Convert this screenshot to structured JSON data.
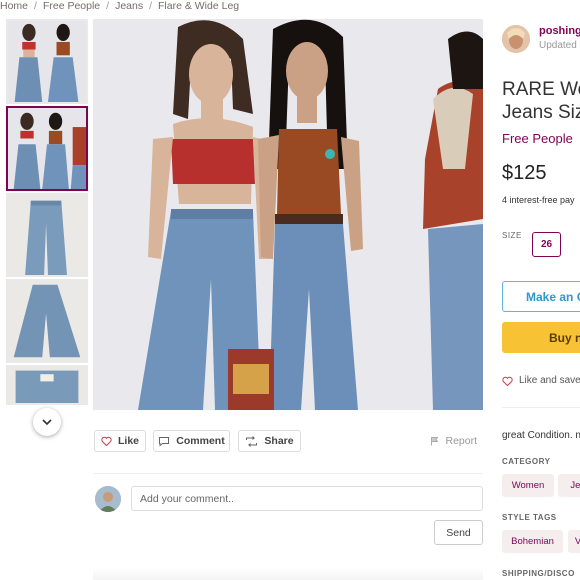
{
  "breadcrumb": [
    "Home",
    "Free People",
    "Jeans",
    "Flare & Wide Leg"
  ],
  "thumbnails": [
    "photo-1",
    "photo-2",
    "photo-3",
    "photo-4",
    "photo-5"
  ],
  "actions": {
    "like": "Like",
    "comment": "Comment",
    "share": "Share",
    "report": "Report"
  },
  "comment": {
    "placeholder": "Add your comment..",
    "send": "Send"
  },
  "seller": {
    "name": "poshing",
    "updated": "Updated"
  },
  "listing": {
    "title_line1": "RARE We",
    "title_line2": "Jeans Siz",
    "brand": "Free People",
    "price": "$125",
    "installments": "4 interest-free pay",
    "size_label": "SIZE",
    "size": "26",
    "offer_button": "Make an O",
    "buy_button": "Buy n",
    "like_save": "Like and save",
    "description": "great Condition. n"
  },
  "category": {
    "heading": "CATEGORY",
    "chips": [
      "Women",
      "Jea"
    ]
  },
  "style_tags": {
    "heading": "STYLE TAGS",
    "chips": [
      "Bohemian",
      "V"
    ]
  },
  "shipping": {
    "heading": "SHIPPING/DISCO"
  },
  "colors": {
    "accent": "#7f0353",
    "offer_blue": "#2b98cf",
    "buy_yellow": "#f8c235"
  }
}
